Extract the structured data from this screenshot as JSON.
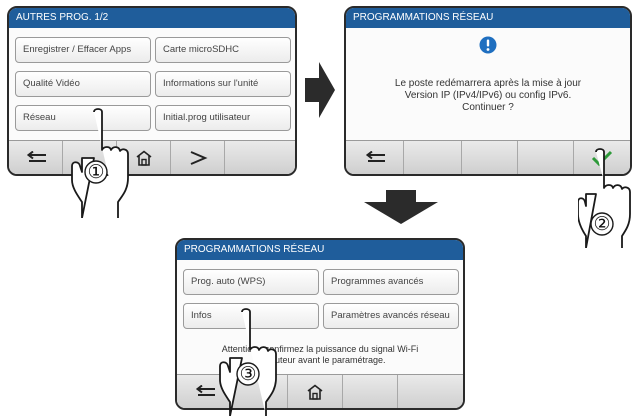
{
  "screen1": {
    "title": "AUTRES PROG. 1/2",
    "buttons": [
      "Enregistrer / Effacer Apps",
      "Carte microSDHC",
      "Qualité Vidéo",
      "Informations sur l'unité",
      "Réseau",
      "Initial.prog utilisateur"
    ],
    "bottom_bar": [
      "back-icon",
      "home-icon",
      "next-icon"
    ]
  },
  "screen2": {
    "title": "PROGRAMMATIONS RÉSEAU",
    "message_lines": [
      "Le poste redémarrera après la mise à jour",
      "Version IP (IPv4/IPv6) ou config IPv6.",
      "Continuer ?"
    ],
    "bottom_bar": [
      "back-icon",
      "check-icon"
    ],
    "accent": "#2e9a3a"
  },
  "screen3": {
    "title": "PROGRAMMATIONS RÉSEAU",
    "buttons": [
      "Prog. auto (WPS)",
      "Programmes avancés",
      "Infos",
      "Paramètres avancés réseau"
    ],
    "message_lines": [
      "Attention : confirmez la puissance du signal Wi-Fi",
      "du routeur avant le paramétrage."
    ],
    "bottom_bar": [
      "back-icon",
      "home-icon"
    ]
  },
  "steps": [
    "①",
    "②",
    "③"
  ],
  "colors": {
    "title_bar": "#1f5d9b",
    "alert_icon": "#1f6fc0",
    "check": "#2e9a3a"
  }
}
